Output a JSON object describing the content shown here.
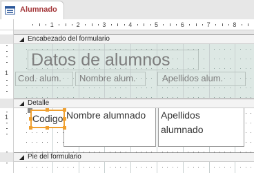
{
  "document_tab": {
    "title": "Alumnado",
    "icon": "form-icon"
  },
  "ruler": {
    "horizontal_numbers": [
      "1",
      "2",
      "3",
      "4",
      "5",
      "6",
      "7",
      "8",
      "9"
    ],
    "vertical_numbers": [
      "1",
      "1"
    ]
  },
  "sections": {
    "header": {
      "label": "Encabezado del formulario"
    },
    "detail": {
      "label": "Detalle"
    },
    "footer": {
      "label": "Pie del formulario"
    }
  },
  "header_controls": {
    "title": "Datos de alumnos",
    "col_codigo": "Cod. alum.",
    "col_nombre": "Nombre alum.",
    "col_apellidos": "Apellidos alum."
  },
  "detail_controls": {
    "codigo": "Codigo",
    "nombre": "Nombre alumnado",
    "apellidos": "Apellidos alumnado"
  },
  "colors": {
    "tab_text": "#a4373a",
    "header_background": "#dde8e4",
    "selection": "#f0a030"
  }
}
